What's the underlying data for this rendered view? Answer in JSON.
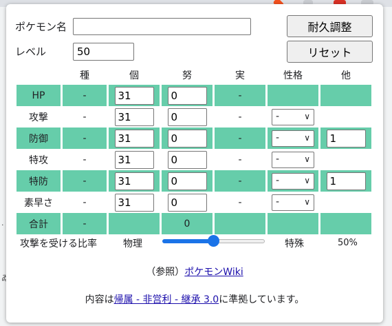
{
  "form": {
    "name_label": "ポケモン名",
    "name_value": "",
    "level_label": "レベル",
    "level_value": "50",
    "durability_button": "耐久調整",
    "reset_button": "リセット"
  },
  "table": {
    "headers": [
      "",
      "種",
      "個",
      "努",
      "実",
      "性格",
      "他"
    ],
    "rows": [
      {
        "stat": "HP",
        "base": "-",
        "iv": "31",
        "ev": "0",
        "actual": "-",
        "nature": "",
        "other": ""
      },
      {
        "stat": "攻撃",
        "base": "-",
        "iv": "31",
        "ev": "0",
        "actual": "-",
        "nature": "-",
        "other": ""
      },
      {
        "stat": "防御",
        "base": "-",
        "iv": "31",
        "ev": "0",
        "actual": "-",
        "nature": "-",
        "other": "1"
      },
      {
        "stat": "特攻",
        "base": "-",
        "iv": "31",
        "ev": "0",
        "actual": "-",
        "nature": "-",
        "other": ""
      },
      {
        "stat": "特防",
        "base": "-",
        "iv": "31",
        "ev": "0",
        "actual": "-",
        "nature": "-",
        "other": "1"
      },
      {
        "stat": "素早さ",
        "base": "-",
        "iv": "31",
        "ev": "0",
        "actual": "-",
        "nature": "-",
        "other": ""
      }
    ],
    "total": {
      "label": "合計",
      "base": "-",
      "ev": "0"
    }
  },
  "ratio": {
    "label": "攻撃を受ける比率",
    "left": "物理",
    "right": "特殊",
    "value_text": "50%",
    "value": 0.5
  },
  "reference": {
    "prefix": "（参照）",
    "link": "ポケモンWiki"
  },
  "license": {
    "prefix": "内容は",
    "link": "帰属 - 非営利 - 継承 3.0",
    "suffix": "に準拠しています。"
  },
  "colors": {
    "stat_row": "#66cdaa",
    "slider": "#1a73e8",
    "link": "#1a0dab"
  }
}
